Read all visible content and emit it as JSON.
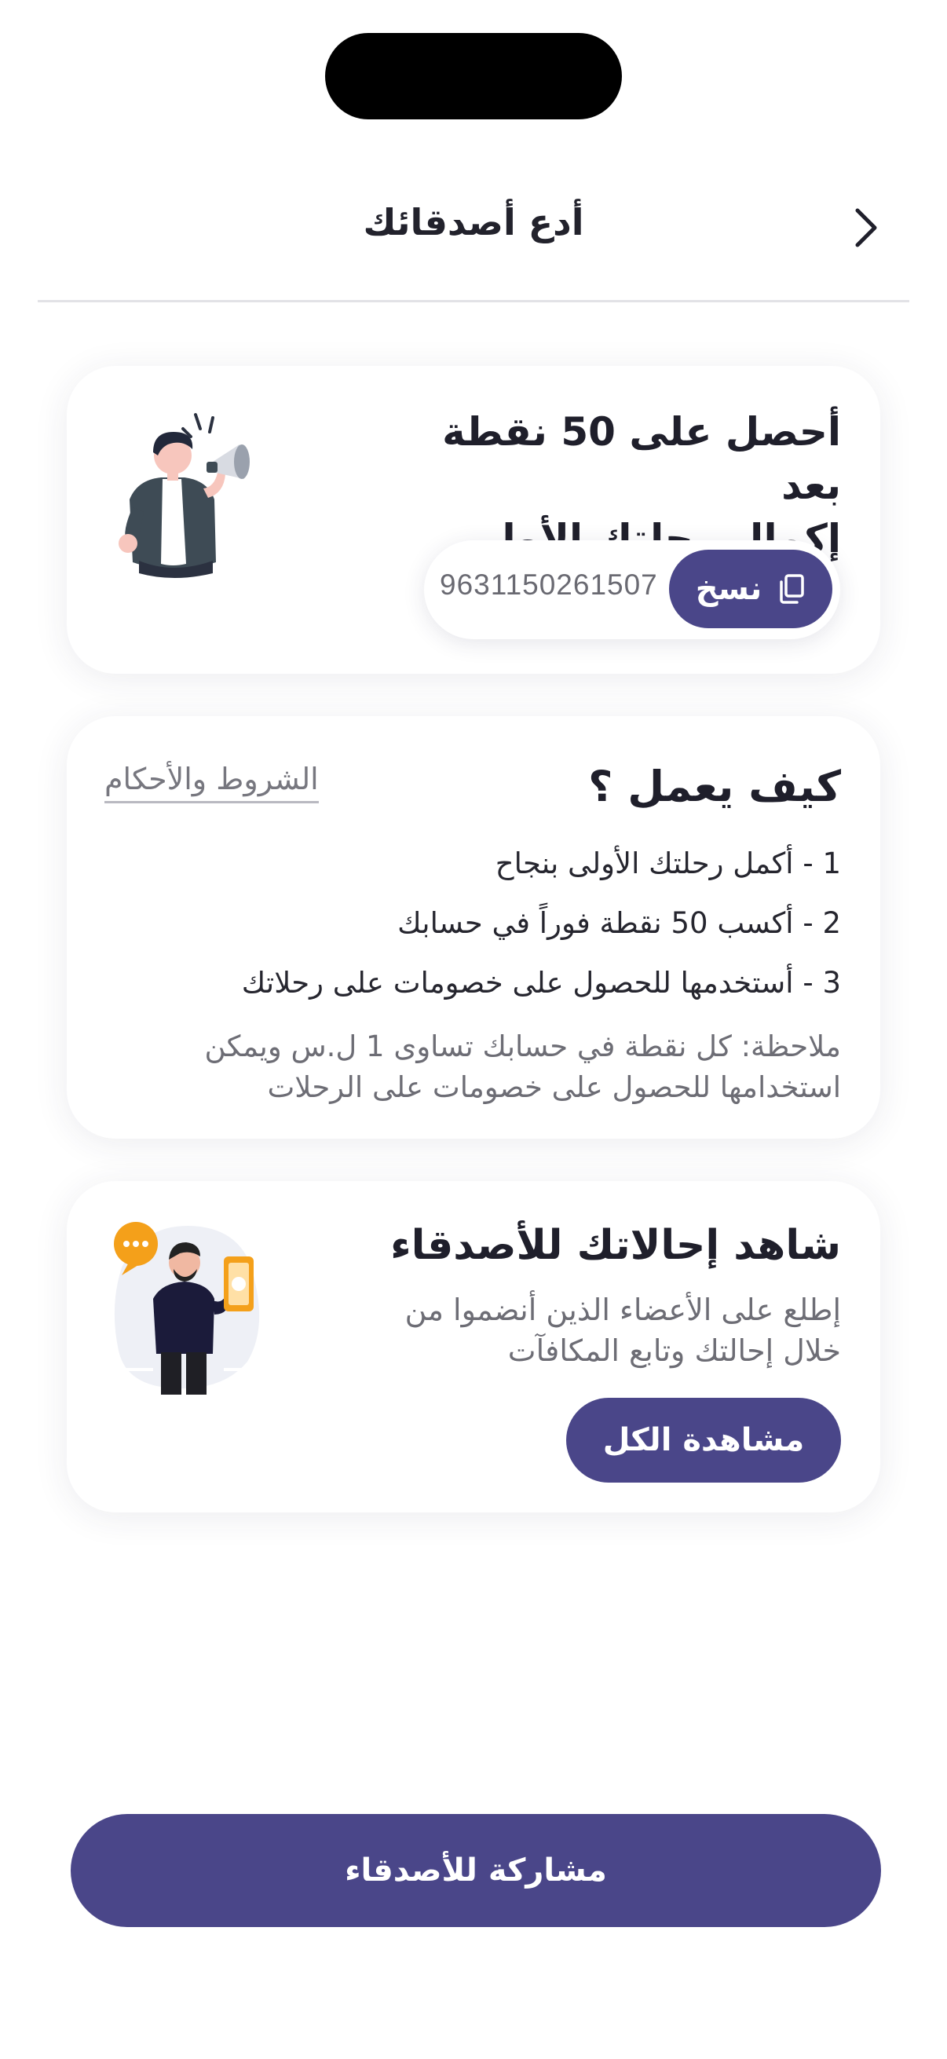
{
  "header": {
    "title": "أدع أصدقائك",
    "back_icon": "chevron-right-icon"
  },
  "promo_card": {
    "title_line1": "أحصل على 50 نقطة بعد",
    "title_line2": "إكمال رحلتك الأولى",
    "referral_code": "9631150261507",
    "copy_label": "نسخ",
    "copy_icon": "copy-icon",
    "illustration": "man-with-megaphone-illustration"
  },
  "how_it_works": {
    "title": "كيف يعمل ؟",
    "terms_link": "الشروط والأحكام",
    "steps": [
      "1 - أكمل رحلتك الأولى بنجاح",
      "2 - أكسب 50 نقطة فوراً في حسابك",
      "3 - أستخدمها للحصول على خصومات على رحلاتك"
    ],
    "note_line1": "ملاحظة: كل نقطة في حسابك تساوى 1 ل.س ويمكن",
    "note_line2": "استخدامها للحصول على خصومات على الرحلات"
  },
  "referrals_card": {
    "title": "شاهد إحالاتك للأصدقاء",
    "desc_line1": "إطلع على الأعضاء الذين أنضموا من",
    "desc_line2": "خلال إحالتك وتابع المكافآت",
    "view_all_label": "مشاهدة الكل",
    "illustration": "man-with-phone-illustration"
  },
  "share_button_label": "مشاركة للأصدقاء",
  "colors": {
    "primary": "#4a4689",
    "text": "#1f1f2b",
    "muted": "#6d6d75",
    "card_bg": "#ffffff"
  }
}
